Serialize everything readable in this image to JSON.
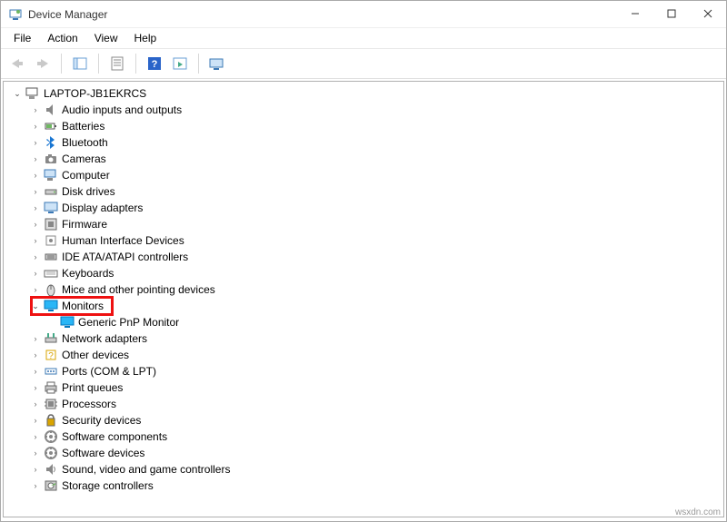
{
  "window": {
    "title": "Device Manager"
  },
  "menu": {
    "file": "File",
    "action": "Action",
    "view": "View",
    "help": "Help"
  },
  "tree": {
    "root": "LAPTOP-JB1EKRCS",
    "items": [
      {
        "label": "Audio inputs and outputs",
        "icon": "audio"
      },
      {
        "label": "Batteries",
        "icon": "battery"
      },
      {
        "label": "Bluetooth",
        "icon": "bluetooth"
      },
      {
        "label": "Cameras",
        "icon": "camera"
      },
      {
        "label": "Computer",
        "icon": "computer"
      },
      {
        "label": "Disk drives",
        "icon": "disk"
      },
      {
        "label": "Display adapters",
        "icon": "display"
      },
      {
        "label": "Firmware",
        "icon": "firmware"
      },
      {
        "label": "Human Interface Devices",
        "icon": "hid"
      },
      {
        "label": "IDE ATA/ATAPI controllers",
        "icon": "ide"
      },
      {
        "label": "Keyboards",
        "icon": "keyboard"
      },
      {
        "label": "Mice and other pointing devices",
        "icon": "mouse"
      },
      {
        "label": "Monitors",
        "icon": "monitor",
        "expanded": true,
        "highlighted": true,
        "children": [
          {
            "label": "Generic PnP Monitor",
            "icon": "monitor"
          }
        ]
      },
      {
        "label": "Network adapters",
        "icon": "network"
      },
      {
        "label": "Other devices",
        "icon": "other"
      },
      {
        "label": "Ports (COM & LPT)",
        "icon": "port"
      },
      {
        "label": "Print queues",
        "icon": "printer"
      },
      {
        "label": "Processors",
        "icon": "cpu"
      },
      {
        "label": "Security devices",
        "icon": "security"
      },
      {
        "label": "Software components",
        "icon": "software"
      },
      {
        "label": "Software devices",
        "icon": "software"
      },
      {
        "label": "Sound, video and game controllers",
        "icon": "sound"
      },
      {
        "label": "Storage controllers",
        "icon": "storage"
      }
    ]
  },
  "watermark": "wsxdn.com"
}
